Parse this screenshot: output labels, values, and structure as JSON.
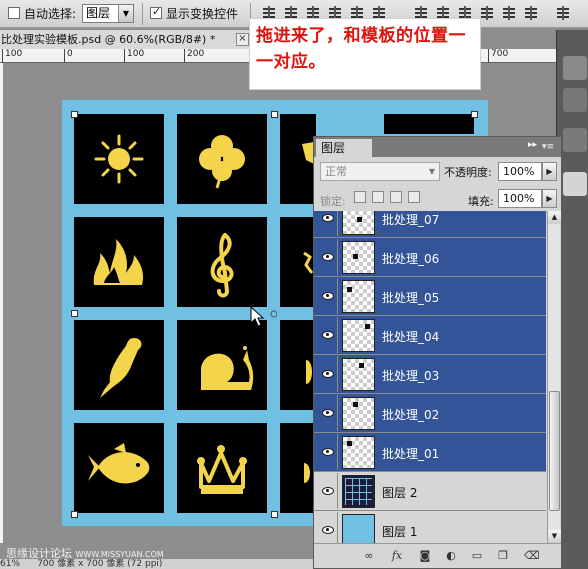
{
  "options_bar": {
    "auto_select_label": "自动选择:",
    "auto_select_checked": false,
    "auto_select_value": "图层",
    "show_transform_label": "显示变换控件",
    "show_transform_checked": true
  },
  "document": {
    "tab_title": "比处理实验模板.psd @ 60.6%(RGB/8#) *",
    "ruler_ticks": [
      "100",
      "0",
      "100",
      "200",
      "700"
    ]
  },
  "callout": {
    "text": "拖进来了，和模板的位置一一对应。"
  },
  "canvas": {
    "background_color": "#6fc0e3",
    "tile_color": "#000000",
    "icon_color": "#f3d44a",
    "tiles": [
      [
        "sun-icon",
        "clover-icon",
        "partial-icon",
        "partial-icon"
      ],
      [
        "flame-icon",
        "treble-clef-icon",
        "partial-icon"
      ],
      [
        "parrot-icon",
        "snail-icon",
        "partial-icon"
      ],
      [
        "fish-icon",
        "crown-icon",
        "partial-icon"
      ]
    ]
  },
  "layers_panel": {
    "tab_label": "图层",
    "blend_mode": "正常",
    "opacity_label": "不透明度:",
    "opacity_value": "100%",
    "lock_label": "锁定:",
    "fill_label": "填充:",
    "fill_value": "100%",
    "layers": [
      {
        "name": "批处理_07",
        "selected": true,
        "thumb": "transparent"
      },
      {
        "name": "批处理_06",
        "selected": true,
        "thumb": "transparent"
      },
      {
        "name": "批处理_05",
        "selected": true,
        "thumb": "transparent"
      },
      {
        "name": "批处理_04",
        "selected": true,
        "thumb": "transparent"
      },
      {
        "name": "批处理_03",
        "selected": true,
        "thumb": "transparent"
      },
      {
        "name": "批处理_02",
        "selected": true,
        "thumb": "transparent"
      },
      {
        "name": "批处理_01",
        "selected": true,
        "thumb": "transparent"
      },
      {
        "name": "图层 2",
        "selected": false,
        "thumb": "grid"
      },
      {
        "name": "图层 1",
        "selected": false,
        "thumb": "blue"
      }
    ],
    "selected_color": "#335597"
  },
  "status": {
    "zoom": "61%",
    "doc_info": "700 像素 x 700 像素 (72 ppi)"
  },
  "watermark": {
    "text": "思缘设计论坛",
    "url": "WWW.MISSYUAN.COM"
  }
}
